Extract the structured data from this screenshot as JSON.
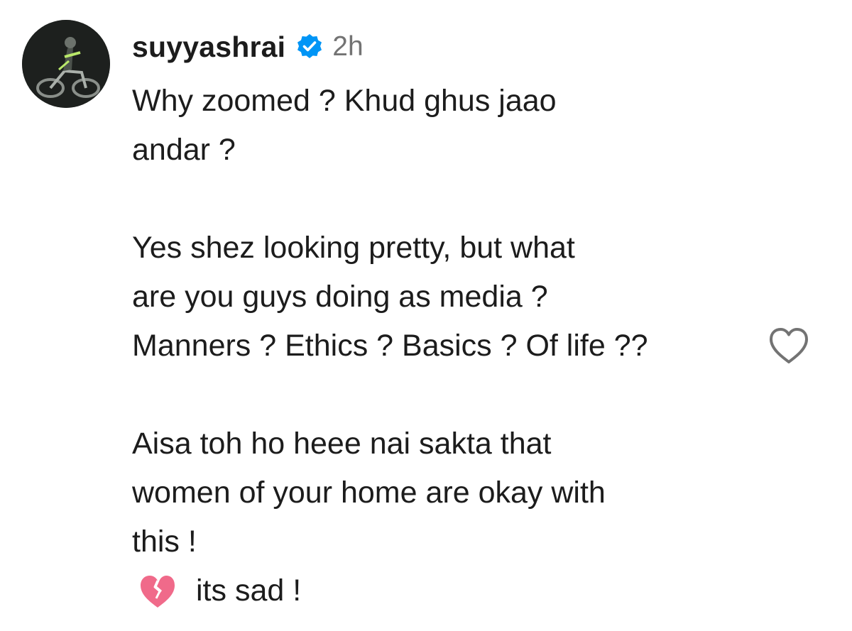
{
  "comment": {
    "username": "suyyashrai",
    "timestamp": "2h",
    "verified_icon": "verified-badge-icon",
    "avatar_icon": "avatar",
    "lines": [
      "Why zoomed ? Khud ghus jaao",
      "andar ?",
      "",
      "Yes shez looking pretty, but what",
      "are you guys doing as media ?",
      "Manners ? Ethics ? Basics ? Of life ??",
      "",
      "Aisa toh ho heee nai sakta that",
      "women of your home are okay with",
      "this !"
    ],
    "closing_emoji": "broken-heart-icon",
    "closing_text": "its sad !",
    "like_icon": "heart-outline-icon"
  },
  "colors": {
    "text": "#1c1c1c",
    "timestamp": "#737373",
    "verified": "#0095f6",
    "like_outline": "#737373",
    "broken_heart": "#f06a8a"
  }
}
